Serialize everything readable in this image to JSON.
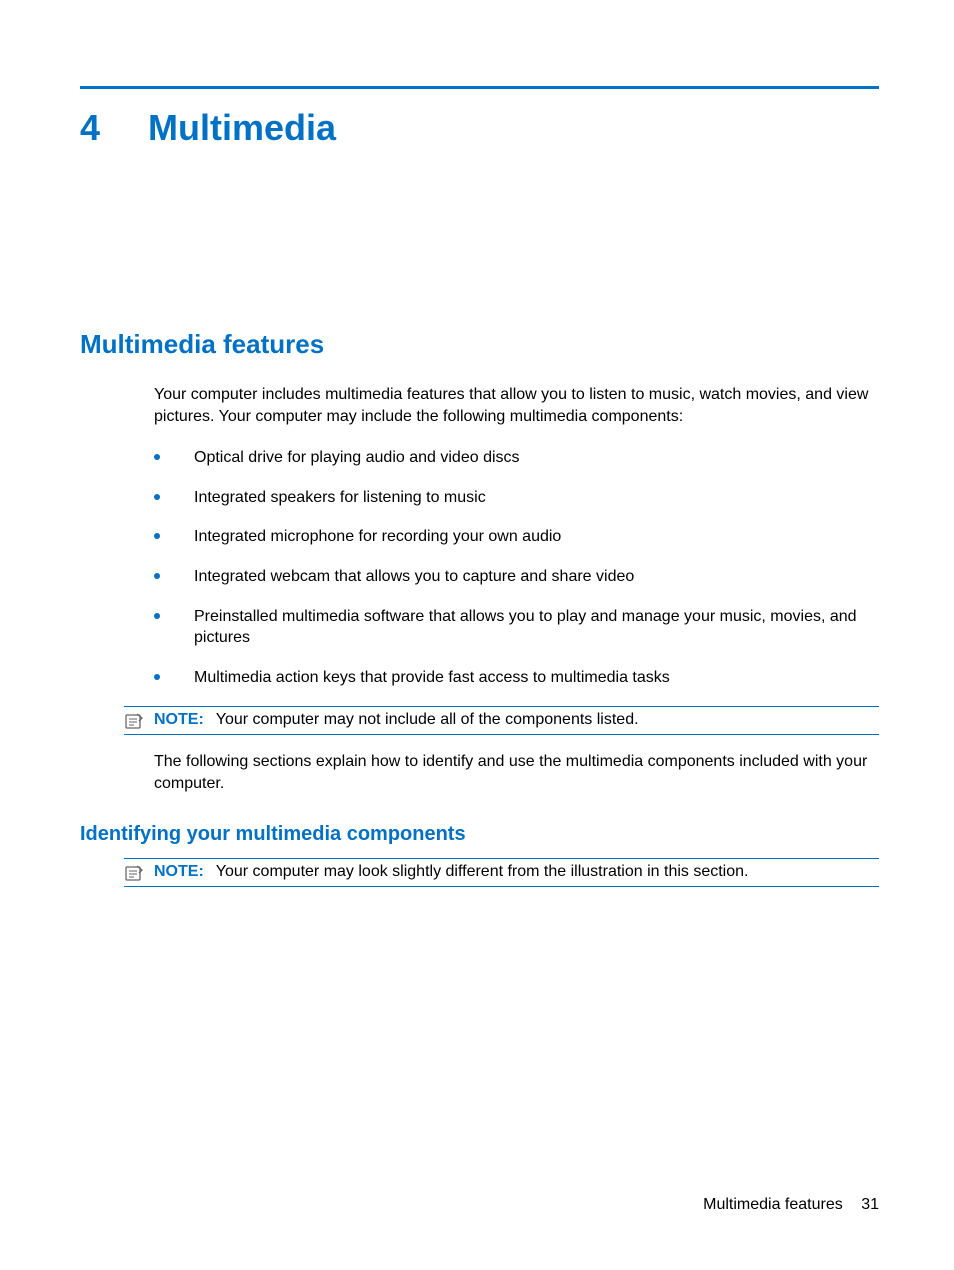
{
  "chapter": {
    "number": "4",
    "title": "Multimedia"
  },
  "section": {
    "heading": "Multimedia features",
    "intro": "Your computer includes multimedia features that allow you to listen to music, watch movies, and view pictures. Your computer may include the following multimedia components:",
    "bullets": [
      "Optical drive for playing audio and video discs",
      "Integrated speakers for listening to music",
      "Integrated microphone for recording your own audio",
      "Integrated webcam that allows you to capture and share video",
      "Preinstalled multimedia software that allows you to play and manage your music, movies, and pictures",
      "Multimedia action keys that provide fast access to multimedia tasks"
    ],
    "note1": {
      "label": "NOTE:",
      "text": "Your computer may not include all of the components listed."
    },
    "follow": "The following sections explain how to identify and use the multimedia components included with your computer."
  },
  "subsection": {
    "heading": "Identifying your multimedia components",
    "note": {
      "label": "NOTE:",
      "text": "Your computer may look slightly different from the illustration in this section."
    }
  },
  "footer": {
    "text": "Multimedia features",
    "page": "31"
  }
}
